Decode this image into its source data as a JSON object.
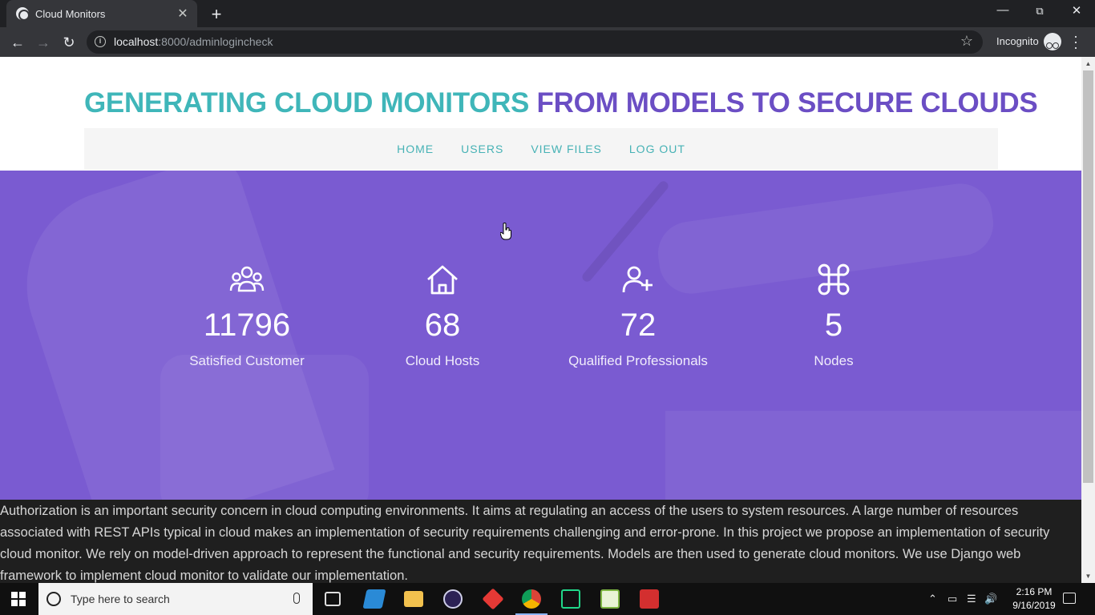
{
  "browser": {
    "tab_title": "Cloud Monitors",
    "tab_close": "✕",
    "new_tab": "+",
    "url_host": "localhost",
    "url_path": ":8000/adminlogincheck",
    "incognito_label": "Incognito",
    "icons": [
      "back-icon",
      "forward-icon",
      "reload-icon",
      "info-icon",
      "star-icon",
      "incognito-icon",
      "menu-icon"
    ]
  },
  "page": {
    "title_part1": "GENERATING CLOUD MONITORS",
    "title_part2": "FROM MODELS TO SECURE CLOUDS",
    "colors": {
      "teal": "#3fb6b9",
      "purple": "#6b4ec4",
      "hero": "#7a5bd1"
    },
    "nav": [
      {
        "label": "HOME"
      },
      {
        "label": "USERS"
      },
      {
        "label": "VIEW FILES"
      },
      {
        "label": "LOG OUT"
      }
    ],
    "stats": [
      {
        "icon": "users-group-icon",
        "value": "11796",
        "label": "Satisfied Customer"
      },
      {
        "icon": "home-icon",
        "value": "68",
        "label": "Cloud Hosts"
      },
      {
        "icon": "add-user-icon",
        "value": "72",
        "label": "Qualified Professionals"
      },
      {
        "icon": "command-icon",
        "value": "5",
        "label": "Nodes"
      }
    ],
    "about": "Authorization is an important security concern in cloud computing environments. It aims at regulating an access of the users to system resources. A large number of resources associated with REST APIs typical in cloud makes an implementation of security requirements challenging and error-prone. In this project we propose an implementation of security cloud monitor. We rely on model-driven approach to represent the functional and security requirements. Models are then used to generate cloud monitors. We use Django web framework to implement cloud monitor to validate our implementation."
  },
  "taskbar": {
    "search_placeholder": "Type here to search",
    "time": "2:16 PM",
    "date": "9/16/2019",
    "apps": [
      "task-view-icon",
      "vscode-icon",
      "file-explorer-icon",
      "eclipse-icon",
      "git-icon",
      "chrome-icon",
      "pycharm-icon",
      "notepad-plus-icon",
      "acrobat-icon"
    ]
  }
}
